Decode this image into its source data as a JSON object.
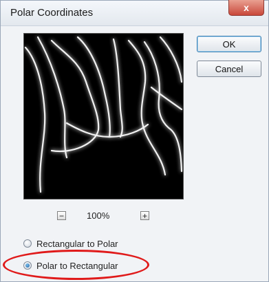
{
  "dialog": {
    "title": "Polar Coordinates",
    "close_glyph": "x"
  },
  "buttons": {
    "ok_label": "OK",
    "cancel_label": "Cancel"
  },
  "zoom": {
    "minus_glyph": "−",
    "plus_glyph": "+",
    "value": "100%"
  },
  "options": {
    "rect_to_polar": "Rectangular to Polar",
    "polar_to_rect": "Polar to Rectangular",
    "selected": "polar_to_rect"
  },
  "annotation": {
    "highlight_color": "#e01a1a"
  }
}
